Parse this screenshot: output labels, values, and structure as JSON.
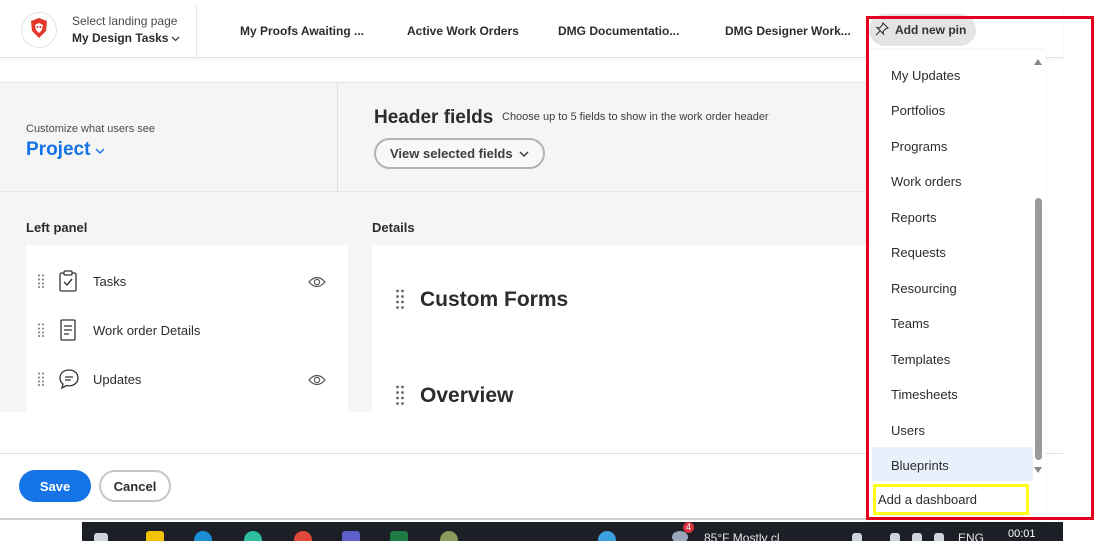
{
  "nav": {
    "landing_label": "Select landing page",
    "landing_value": "My Design Tasks",
    "pins": [
      {
        "label": "My Proofs Awaiting ..."
      },
      {
        "label": "Active Work Orders"
      },
      {
        "label": "DMG Documentatio..."
      },
      {
        "label": "DMG Designer Work..."
      }
    ],
    "add_pin_label": "Add new pin"
  },
  "customize": {
    "label": "Customize what users see",
    "object": "Project",
    "header_title": "Header fields",
    "header_help": "Choose up to 5 fields to show in the work order header",
    "view_button": "View selected fields"
  },
  "left_panel": {
    "title": "Left panel",
    "items": [
      {
        "label": "Tasks",
        "icon": "clipboard-check-icon",
        "visible": true
      },
      {
        "label": "Work order Details",
        "icon": "document-icon",
        "visible": false
      },
      {
        "label": "Updates",
        "icon": "chat-bubble-icon",
        "visible": true
      }
    ]
  },
  "details": {
    "title": "Details",
    "sections": [
      {
        "label": "Custom Forms"
      },
      {
        "label": "Overview"
      }
    ]
  },
  "footer": {
    "save": "Save",
    "cancel": "Cancel"
  },
  "dropdown": {
    "items": [
      {
        "label": "My Updates"
      },
      {
        "label": "Portfolios"
      },
      {
        "label": "Programs"
      },
      {
        "label": "Work orders"
      },
      {
        "label": "Reports"
      },
      {
        "label": "Requests"
      },
      {
        "label": "Resourcing"
      },
      {
        "label": "Teams"
      },
      {
        "label": "Templates"
      },
      {
        "label": "Timesheets"
      },
      {
        "label": "Users"
      },
      {
        "label": "Blueprints"
      }
    ],
    "highlighted": "Blueprints",
    "add_dashboard": "Add a dashboard"
  },
  "taskbar": {
    "weather": "85°F  Mostly cl",
    "lang": "ENG",
    "clock": "00:01",
    "badge": "4"
  },
  "colors": {
    "accent": "#1473e6",
    "highlight_red": "#e4001f",
    "highlight_yellow": "#ffff19"
  }
}
